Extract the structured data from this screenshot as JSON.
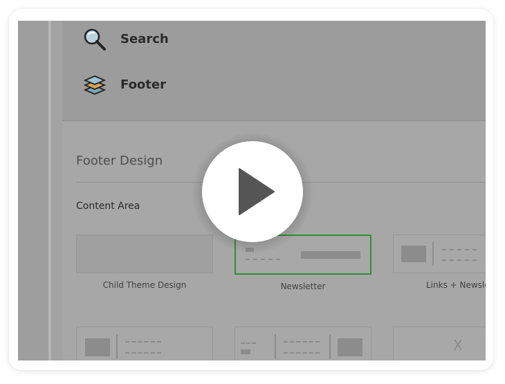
{
  "nav": {
    "search_label": "Search",
    "footer_label": "Footer"
  },
  "section": {
    "title": "Footer Design",
    "content_area_label": "Content Area"
  },
  "layouts": [
    {
      "caption": "Child Theme Design"
    },
    {
      "caption": "Newsletter"
    },
    {
      "caption": "Links + Newslet"
    },
    {
      "caption": ""
    },
    {
      "caption": ""
    },
    {
      "caption": ""
    }
  ],
  "layout6_glyph": "X",
  "colors": {
    "overlay_gray": "#a3a3a3",
    "selected_border": "#2f8f2f",
    "play_button": "#ffffff",
    "play_icon": "#555555"
  },
  "icons": {
    "search": "magnifier-icon",
    "footer": "layers-icon",
    "play": "play-icon"
  }
}
